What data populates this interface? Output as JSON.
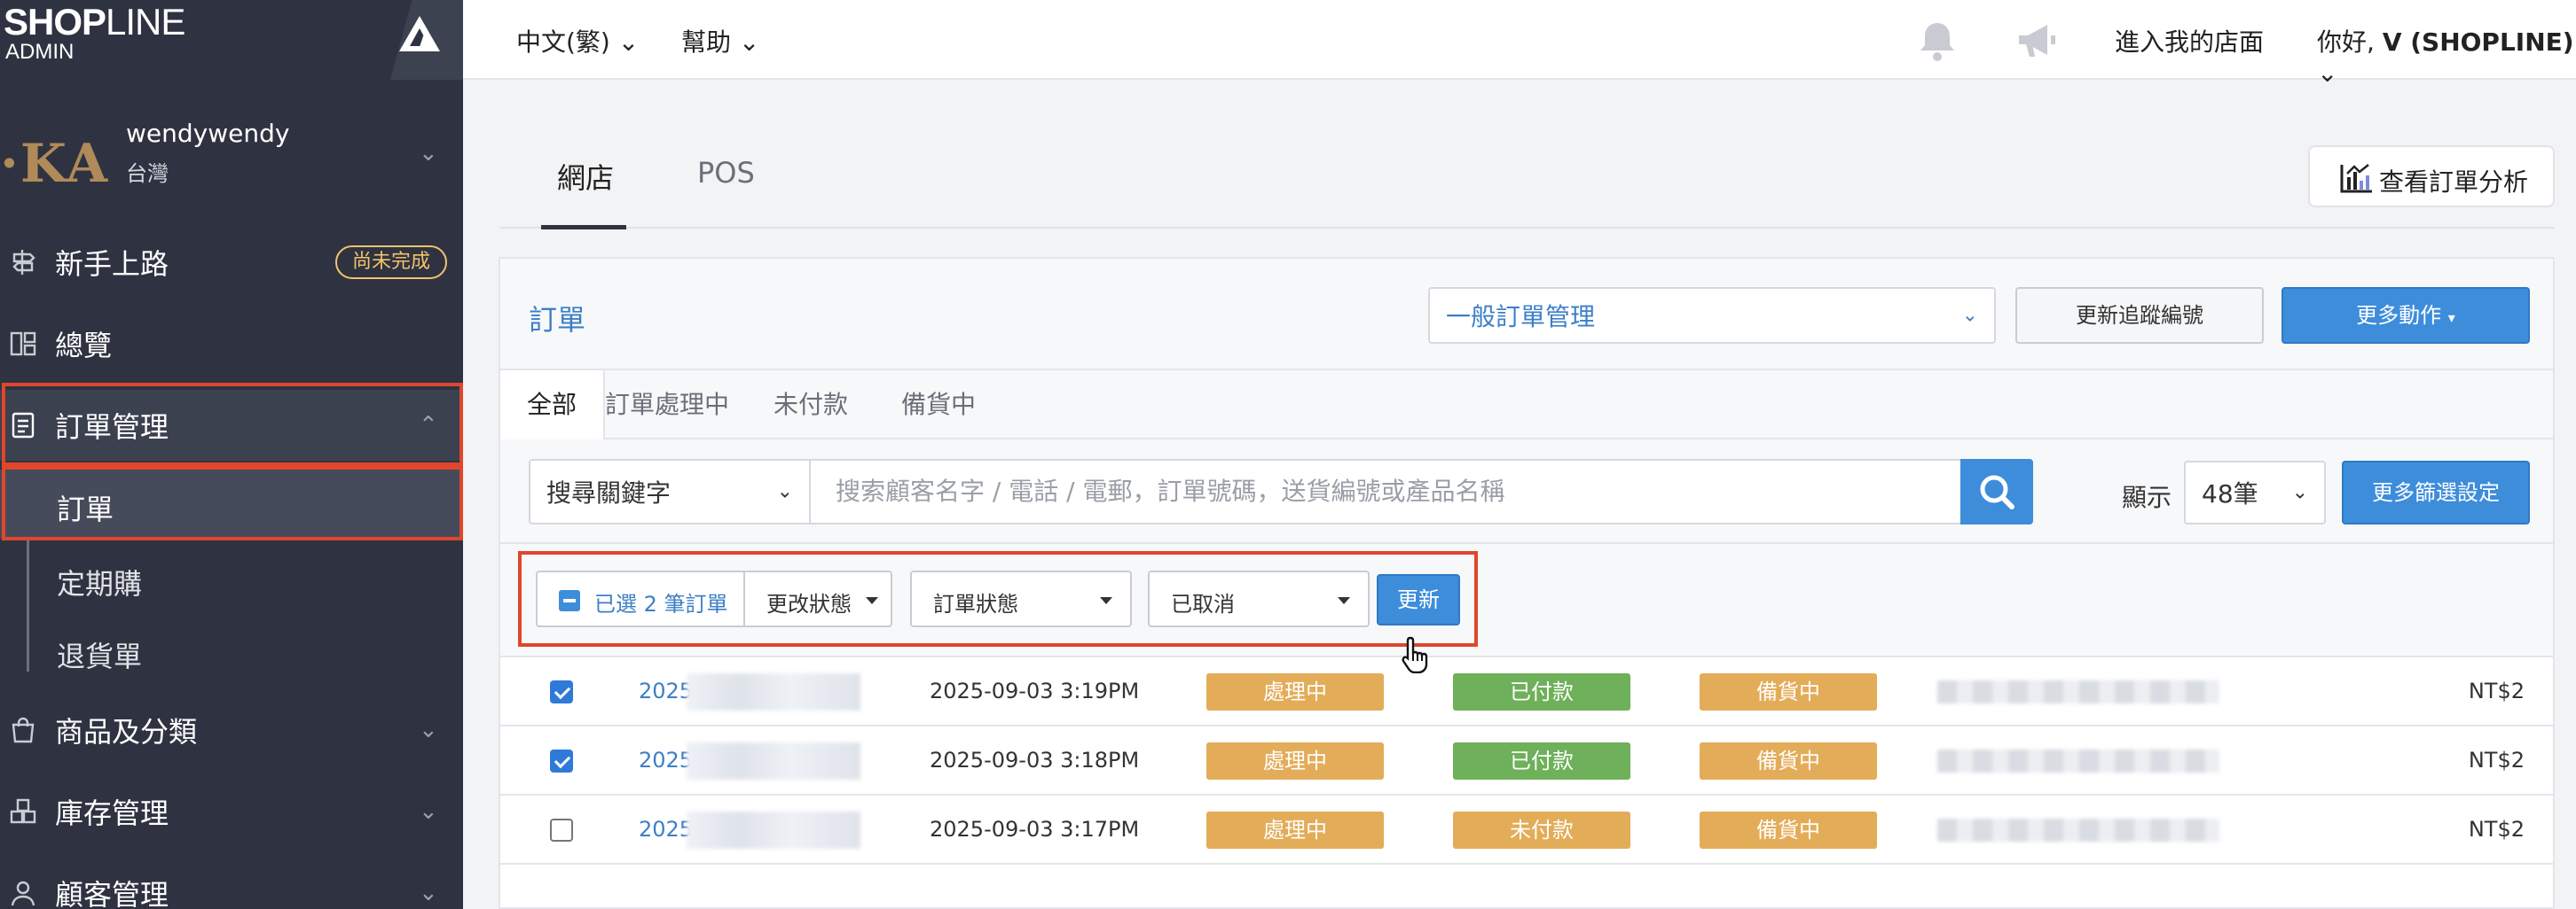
{
  "brand": {
    "logo_bold": "SHOP",
    "logo_thin": "LINE",
    "logo_sub": "ADMIN"
  },
  "store": {
    "avatar_text": "·KA",
    "name": "wendywendy",
    "region": "台灣"
  },
  "sidebar": {
    "onboarding": {
      "label": "新手上路",
      "badge": "尚未完成"
    },
    "overview": {
      "label": "總覽"
    },
    "orders": {
      "label": "訂單管理",
      "sub": [
        {
          "label": "訂單"
        },
        {
          "label": "定期購"
        },
        {
          "label": "退貨單"
        }
      ]
    },
    "products": {
      "label": "商品及分類"
    },
    "inventory": {
      "label": "庫存管理"
    },
    "customers": {
      "label": "顧客管理"
    }
  },
  "topbar": {
    "language": "中文(繁)",
    "help": "幫助",
    "enter_store": "進入我的店面",
    "greeting_prefix": "你好, ",
    "greeting_user": "V (SHOPLINE)"
  },
  "main_tabs": [
    {
      "label": "網店"
    },
    {
      "label": "POS"
    }
  ],
  "analytics_button": "查看訂單分析",
  "card": {
    "title": "訂單",
    "management_select": "一般訂單管理",
    "update_tracking": "更新追蹤編號",
    "more_actions": "更多動作"
  },
  "filter_tabs": [
    {
      "label": "全部"
    },
    {
      "label": "訂單處理中"
    },
    {
      "label": "未付款"
    },
    {
      "label": "備貨中"
    }
  ],
  "search": {
    "keyword_select": "搜尋關鍵字",
    "placeholder": "搜索顧客名字 / 電話 / 電郵，訂單號碼，送貨編號或產品名稱",
    "show_label": "顯示",
    "per_page": "48筆",
    "more_filters": "更多篩選設定"
  },
  "bulk": {
    "selected": "已選 2 筆訂單",
    "change_status": "更改狀態",
    "status_type": "訂單狀態",
    "status_value": "已取消",
    "update": "更新"
  },
  "orders": [
    {
      "checked": true,
      "order_no": "2025",
      "date": "2025-09-03 3:19PM",
      "order_status": "處理中",
      "payment_status": "已付款",
      "delivery_status": "備貨中",
      "amount": "NT$2"
    },
    {
      "checked": true,
      "order_no": "2025",
      "date": "2025-09-03 3:18PM",
      "order_status": "處理中",
      "payment_status": "已付款",
      "delivery_status": "備貨中",
      "amount": "NT$2"
    },
    {
      "checked": false,
      "order_no": "2025",
      "date": "2025-09-03 3:17PM",
      "order_status": "處理中",
      "payment_status": "未付款",
      "delivery_status": "備貨中",
      "amount": "NT$2"
    }
  ],
  "colors": {
    "sidebar_bg": "#2f3341",
    "accent_blue": "#3d8ddb",
    "highlight_red": "#e0462b",
    "pill_orange": "#e3ac58",
    "pill_green": "#6fb05a"
  },
  "icons": {
    "collapse": "logo-mark-icon",
    "onboarding": "signpost-icon",
    "overview": "dashboard-icon",
    "orders": "clipboard-icon",
    "products": "bag-icon",
    "inventory": "boxes-icon",
    "customers": "user-icon",
    "bell": "bell-icon",
    "announcement": "megaphone-icon",
    "analytics": "chart-icon",
    "search": "search-icon",
    "cursor": "hand-pointer-icon"
  }
}
